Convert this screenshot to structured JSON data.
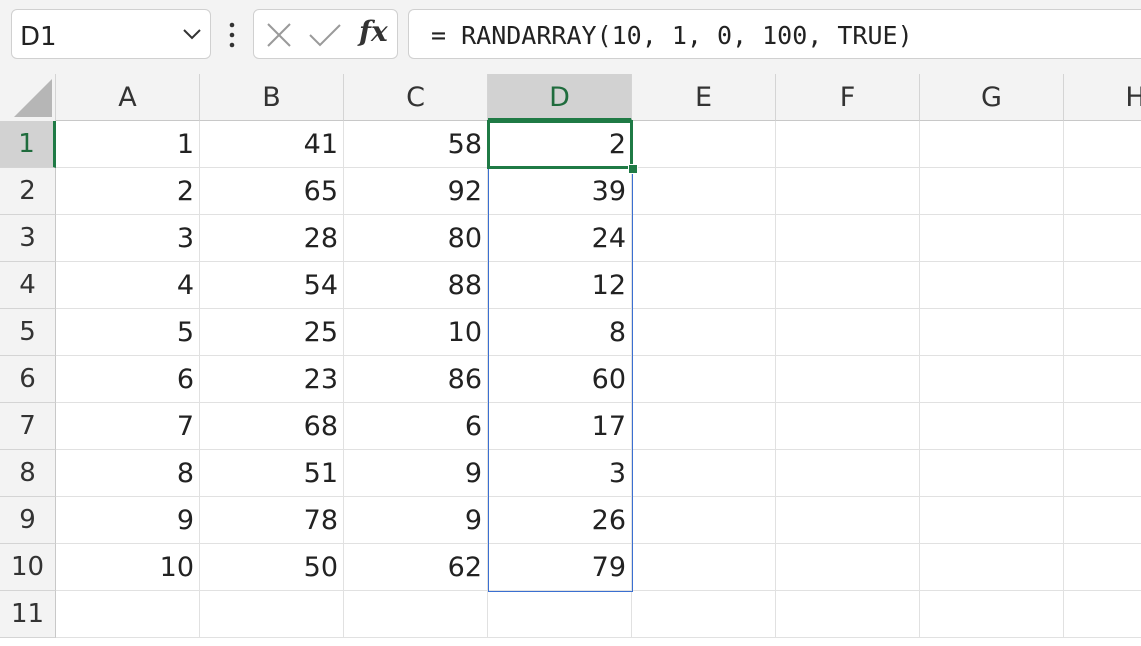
{
  "name_box": {
    "value": "D1"
  },
  "formula_bar": {
    "formula": "= RANDARRAY(10, 1, 0, 100, TRUE)"
  },
  "icons": {
    "cancel": "x-icon",
    "enter": "check-icon",
    "function": "fx-icon",
    "dropdown": "chevron-down-icon",
    "more": "vertical-dots-icon"
  },
  "toolbar": {
    "fx_label": "fx"
  },
  "columns": [
    "A",
    "B",
    "C",
    "D",
    "E",
    "F",
    "G",
    "H"
  ],
  "rows": [
    "1",
    "2",
    "3",
    "4",
    "5",
    "6",
    "7",
    "8",
    "9",
    "10",
    "11"
  ],
  "cells": [
    [
      "1",
      "41",
      "58",
      "2",
      "",
      "",
      "",
      ""
    ],
    [
      "2",
      "65",
      "92",
      "39",
      "",
      "",
      "",
      ""
    ],
    [
      "3",
      "28",
      "80",
      "24",
      "",
      "",
      "",
      ""
    ],
    [
      "4",
      "54",
      "88",
      "12",
      "",
      "",
      "",
      ""
    ],
    [
      "5",
      "25",
      "10",
      "8",
      "",
      "",
      "",
      ""
    ],
    [
      "6",
      "23",
      "86",
      "60",
      "",
      "",
      "",
      ""
    ],
    [
      "7",
      "68",
      "6",
      "17",
      "",
      "",
      "",
      ""
    ],
    [
      "8",
      "51",
      "9",
      "3",
      "",
      "",
      "",
      ""
    ],
    [
      "9",
      "78",
      "9",
      "26",
      "",
      "",
      "",
      ""
    ],
    [
      "10",
      "50",
      "62",
      "79",
      "",
      "",
      "",
      ""
    ],
    [
      "",
      "",
      "",
      "",
      "",
      "",
      "",
      ""
    ]
  ],
  "selection": {
    "active_cell": "D1",
    "spill_range": "D1:D10"
  },
  "colors": {
    "accent_green": "#1f7a45",
    "spill_blue": "#3b6fd1",
    "header_bg": "#f3f3f3",
    "header_selected_bg": "#d2d2d2"
  }
}
